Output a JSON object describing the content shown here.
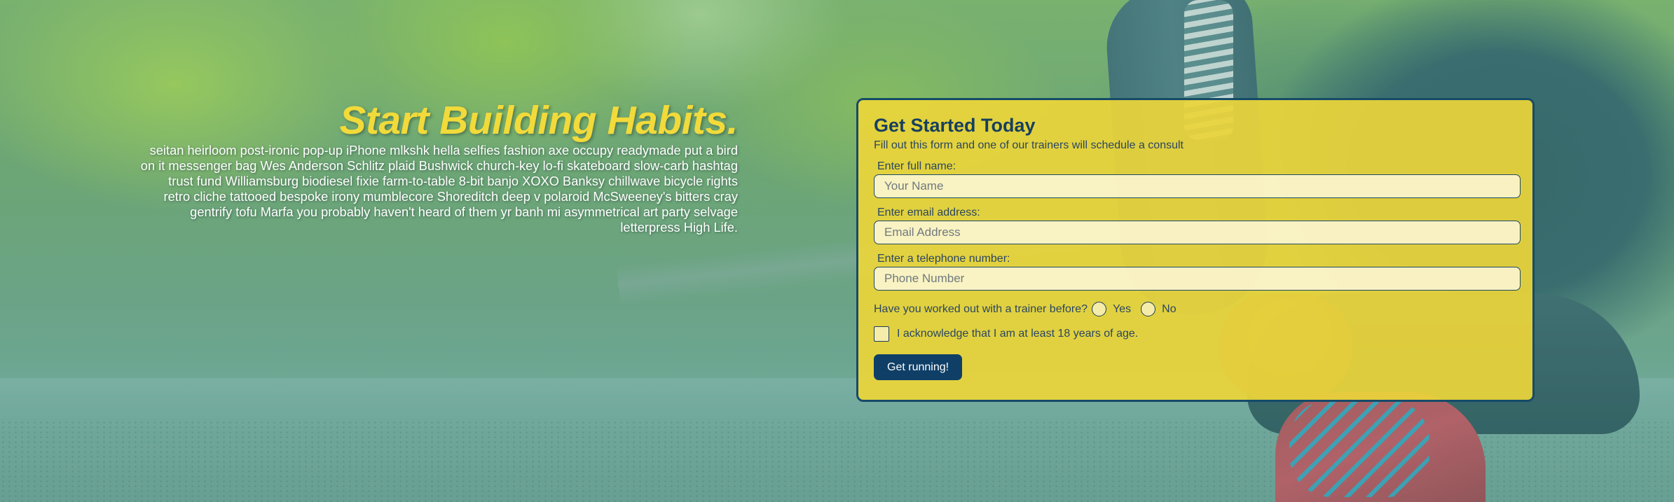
{
  "hero": {
    "heading": "Start Building Habits.",
    "body": "seitan heirloom post-ironic pop-up iPhone mlkshk hella selfies fashion axe occupy readymade put a bird on it messenger bag Wes Anderson Schlitz plaid Bushwick church-key lo-fi skateboard slow-carb hashtag trust fund Williamsburg biodiesel fixie farm-to-table 8-bit banjo XOXO Banksy chillwave bicycle rights retro cliche tattooed bespoke irony mumblecore Shoreditch deep v polaroid McSweeney's bitters cray gentrify tofu Marfa you probably haven't heard of them yr banh mi asymmetrical art party selvage letterpress High Life."
  },
  "form": {
    "title": "Get Started Today",
    "subtitle": "Fill out this form and one of our trainers will schedule a consult",
    "name_label": "Enter full name:",
    "name_placeholder": "Your Name",
    "email_label": "Enter email address:",
    "email_placeholder": "Email Address",
    "phone_label": "Enter a telephone number:",
    "phone_placeholder": "Phone Number",
    "trainer_question": "Have you worked out with a trainer before?",
    "option_yes": "Yes",
    "option_no": "No",
    "age_ack": "I acknowledge that I am at least 18 years of age.",
    "submit_label": "Get running!"
  },
  "colors": {
    "accent_yellow": "#f1da3a",
    "card_bg": "#ecd53a",
    "card_border": "#164b68",
    "button_bg": "#0f3f66"
  }
}
